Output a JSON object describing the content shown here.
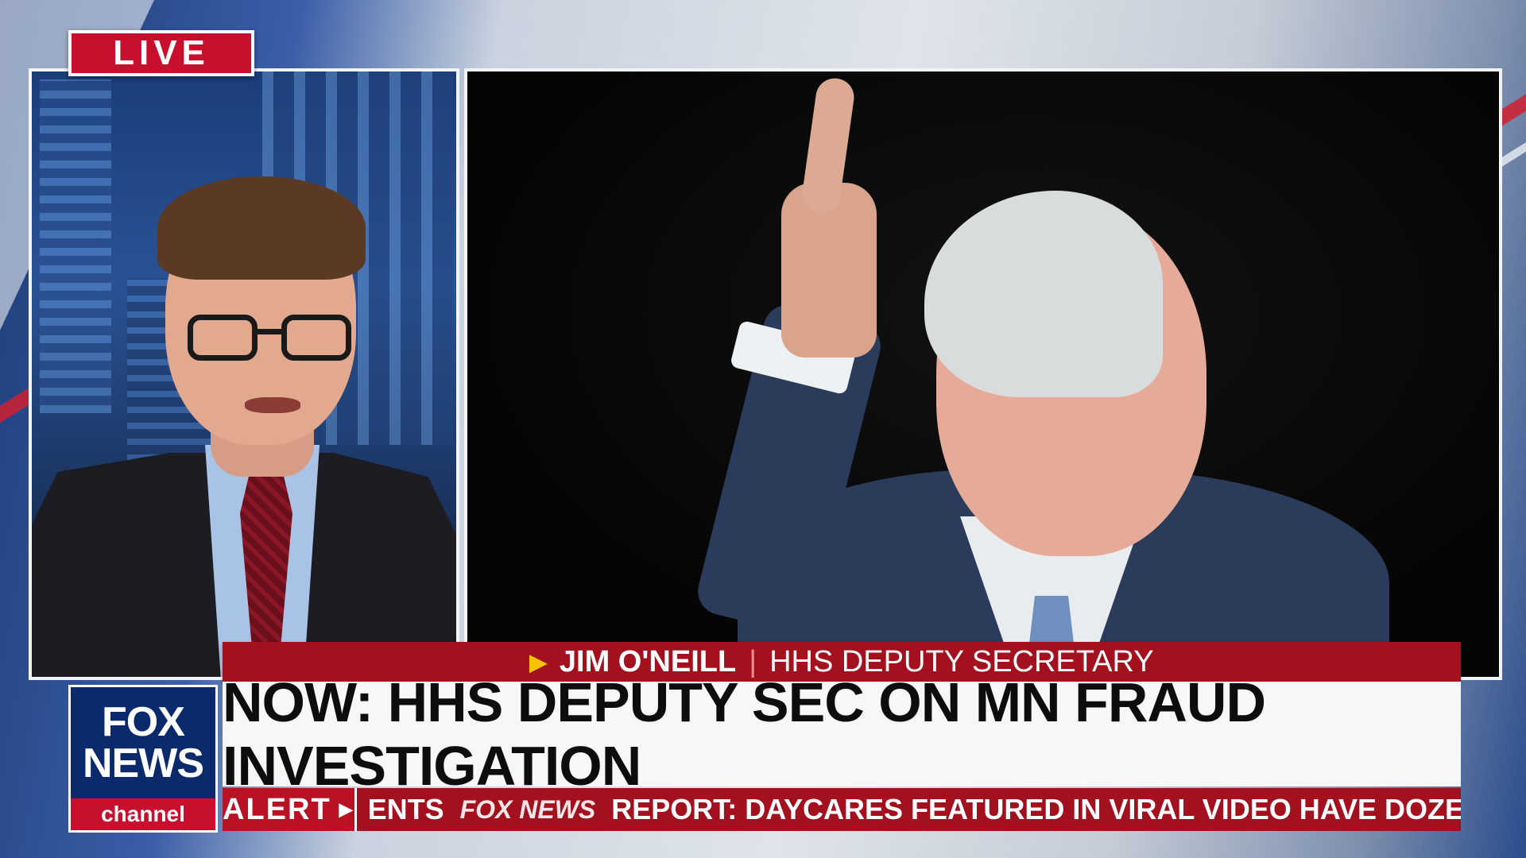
{
  "live_label": "LIVE",
  "lower_third": {
    "name": "JIM O'NEILL",
    "separator": "|",
    "title": "HHS DEPUTY SECRETARY",
    "headline": "NOW: HHS DEPUTY SEC ON MN FRAUD INVESTIGATION"
  },
  "logo": {
    "line1": "FOX",
    "line2": "NEWS",
    "line3": "channel"
  },
  "ticker": {
    "label": "ALERT",
    "lead_text": "ENTS",
    "brand": "FOX NEWS",
    "text": "REPORT: DAYCARES FEATURED IN VIRAL VIDEO HAVE DOZEN"
  },
  "colors": {
    "brand_red": "#a3111f",
    "live_red": "#c8102e",
    "fox_blue": "#0b2a6b",
    "accent_yellow": "#f6c200"
  },
  "icons": [
    "play-triangle-icon",
    "chevron-right-icon"
  ]
}
